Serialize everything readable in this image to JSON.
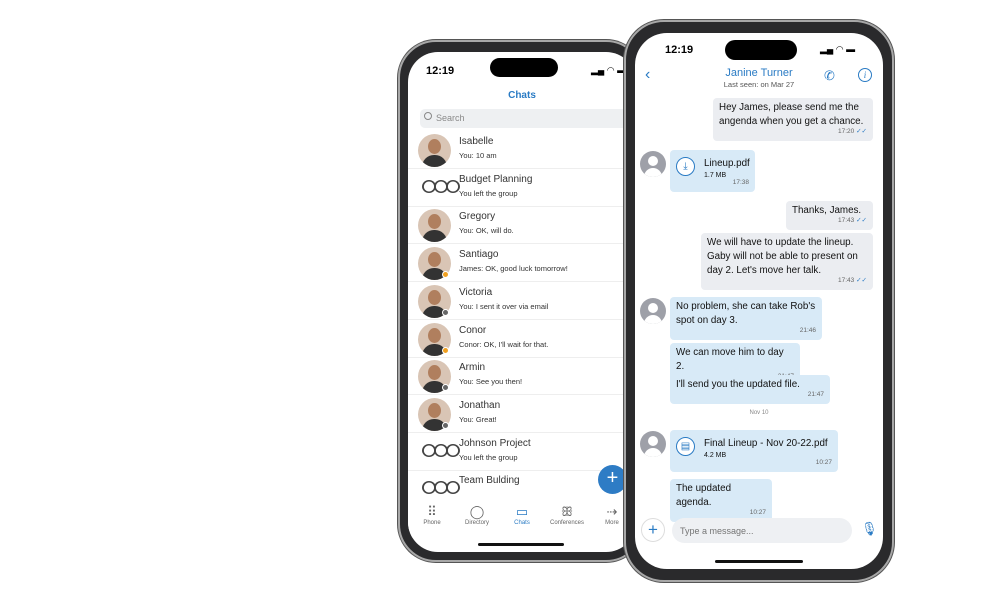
{
  "status_time": "12:19",
  "chats_screen": {
    "title": "Chats",
    "search_placeholder": "Search",
    "chats": [
      {
        "name": "Isabelle",
        "preview": "You: 10 am",
        "type": "person",
        "status": ""
      },
      {
        "name": "Budget Planning",
        "preview": "You left the group",
        "type": "group",
        "status": ""
      },
      {
        "name": "Gregory",
        "preview": "You: OK, will do.",
        "type": "person",
        "status": ""
      },
      {
        "name": "Santiago",
        "preview": "James: OK, good luck tomorrow!",
        "type": "person",
        "status": "away"
      },
      {
        "name": "Victoria",
        "preview": "You: I sent it over via email",
        "type": "person",
        "status": "offline"
      },
      {
        "name": "Conor",
        "preview": "Conor: OK, I'll wait for that.",
        "type": "person",
        "status": "away"
      },
      {
        "name": "Armin",
        "preview": "You: See you then!",
        "type": "person",
        "status": "offline"
      },
      {
        "name": "Jonathan",
        "preview": "You: Great!",
        "type": "person",
        "status": "offline"
      },
      {
        "name": "Johnson Project",
        "preview": "You left the group",
        "type": "group",
        "status": ""
      },
      {
        "name": "Team Bulding",
        "preview": "",
        "type": "group",
        "status": ""
      }
    ],
    "tabs": [
      {
        "label": "Phone",
        "icon": "dialpad-icon"
      },
      {
        "label": "Directory",
        "icon": "person-icon"
      },
      {
        "label": "Chats",
        "icon": "chat-bubble-icon",
        "active": true
      },
      {
        "label": "Conferences",
        "icon": "group-icon"
      },
      {
        "label": "More",
        "icon": "arrow-right-icon"
      }
    ]
  },
  "conversation": {
    "contact_name": "Janine Turner",
    "last_seen": "Last seen: on Mar 27",
    "messages": [
      {
        "dir": "sent",
        "text": "Hey James, please send me the angenda when you get a chance.",
        "time": "17:20"
      },
      {
        "dir": "recv",
        "file": "Lineup.pdf",
        "size": "1.7 MB",
        "time": "17:38"
      },
      {
        "dir": "sent",
        "text": "Thanks, James.",
        "time": "17:43"
      },
      {
        "dir": "sent",
        "text": "We will have to update the lineup. Gaby will not be able to present on day 2. Let's move her talk.",
        "time": "17:43"
      },
      {
        "dir": "recv",
        "text": "No problem, she can take Rob's spot on day 3.",
        "time": "21:46"
      },
      {
        "dir": "recv",
        "text": "We can move him to day 2.",
        "time": "21:47"
      },
      {
        "dir": "recv",
        "text": "I'll send you the updated file.",
        "time": "21:47"
      },
      {
        "dir": "recv",
        "file": "Final Lineup - Nov 20-22.pdf",
        "size": "4.2 MB",
        "time": "10:27"
      },
      {
        "dir": "recv",
        "text": "The updated agenda.",
        "time": "10:27"
      }
    ],
    "date_separator": "Nov 10",
    "input_placeholder": "Type a message..."
  },
  "colors": {
    "accent": "#2a7bc4",
    "sent_bubble": "#ebedf1",
    "received_bubble": "#d8eaf7",
    "away": "#f0a020",
    "offline": "#666666"
  }
}
